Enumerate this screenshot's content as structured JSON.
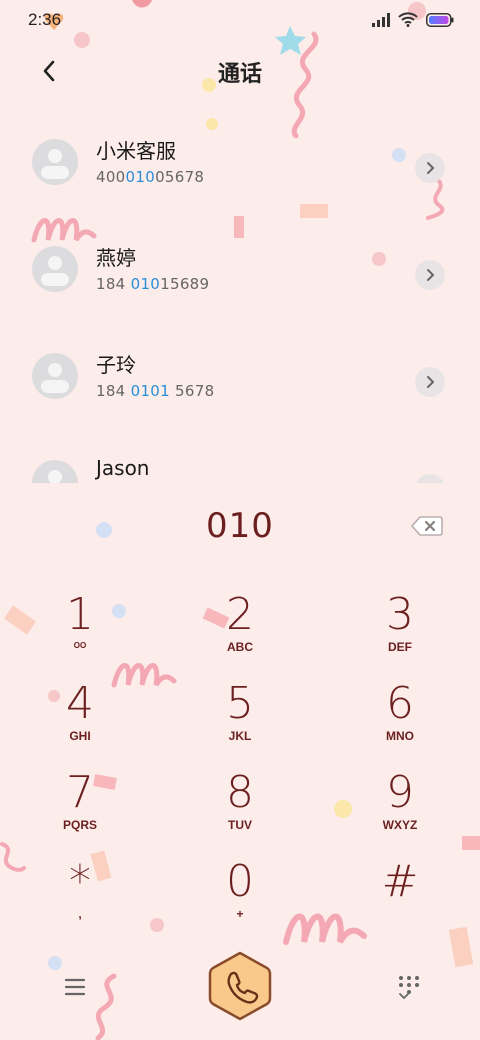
{
  "status_bar": {
    "time": "2:36"
  },
  "header": {
    "title": "通话"
  },
  "contacts": [
    {
      "name": "小米客服",
      "num_pre": "400",
      "num_hl": "010",
      "num_post": "05678"
    },
    {
      "name": "燕婷",
      "num_pre": "184 ",
      "num_hl": "010",
      "num_post": "15689"
    },
    {
      "name": "子玲",
      "num_pre": "184 ",
      "num_hl": "0101",
      "num_post": " 5678"
    },
    {
      "name": "Jason",
      "num_pre": "",
      "num_hl": "",
      "num_post": ""
    }
  ],
  "dial_input": {
    "value": "010"
  },
  "keypad": [
    {
      "digit": "1",
      "letters": "ᴼᴼ"
    },
    {
      "digit": "2",
      "letters": "ABC"
    },
    {
      "digit": "3",
      "letters": "DEF"
    },
    {
      "digit": "4",
      "letters": "GHI"
    },
    {
      "digit": "5",
      "letters": "JKL"
    },
    {
      "digit": "6",
      "letters": "MNO"
    },
    {
      "digit": "7",
      "letters": "PQRS"
    },
    {
      "digit": "8",
      "letters": "TUV"
    },
    {
      "digit": "9",
      "letters": "WXYZ"
    },
    {
      "digit": "*",
      "letters": ","
    },
    {
      "digit": "0",
      "letters": "+"
    },
    {
      "digit": "#",
      "letters": ""
    }
  ],
  "icons": {
    "back": "chevron-left-icon",
    "backspace": "backspace-icon",
    "menu": "menu-icon",
    "call": "phone-icon",
    "keypad_toggle": "dialpad-icon"
  },
  "colors": {
    "background": "#fcecea",
    "digit": "#6b1f1f",
    "highlight": "#2a8fd6",
    "call_button": "#f8c98a"
  }
}
